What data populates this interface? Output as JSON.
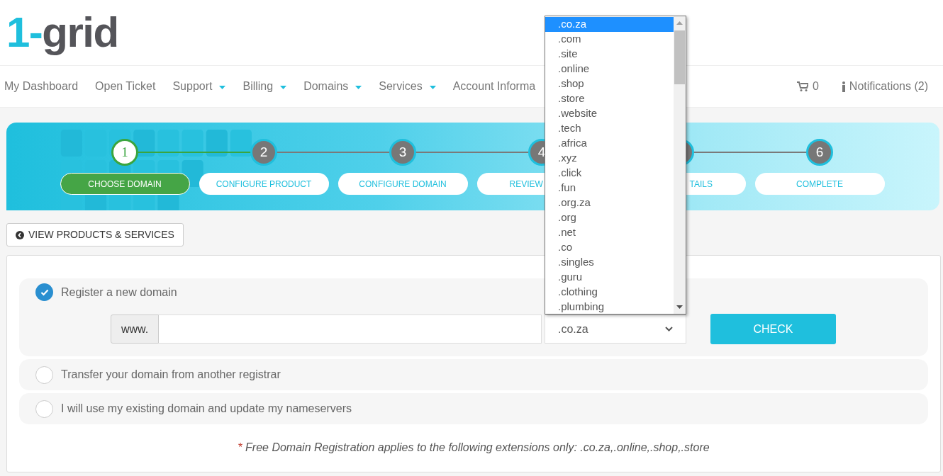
{
  "logo": {
    "accent": "1-",
    "text": "grid"
  },
  "nav": {
    "items": [
      {
        "label": "My Dashboard",
        "dropdown": false
      },
      {
        "label": "Open Ticket",
        "dropdown": false
      },
      {
        "label": "Support",
        "dropdown": true
      },
      {
        "label": "Billing",
        "dropdown": true
      },
      {
        "label": "Domains",
        "dropdown": true
      },
      {
        "label": "Services",
        "dropdown": true
      },
      {
        "label": "Account Informa",
        "dropdown": false
      }
    ],
    "cart_count": "0",
    "notifications": "Notifications (2)"
  },
  "steps": [
    {
      "number": "1",
      "label": "CHOOSE DOMAIN",
      "selected": true
    },
    {
      "number": "2",
      "label": "CONFIGURE PRODUCT",
      "selected": false
    },
    {
      "number": "3",
      "label": "CONFIGURE DOMAIN",
      "selected": false
    },
    {
      "number": "4",
      "label": "REVIEW",
      "selected": false
    },
    {
      "label": "TAILS",
      "selected": false
    },
    {
      "number": "6",
      "label": "COMPLETE",
      "selected": false
    }
  ],
  "back_button": "VIEW PRODUCTS & SERVICES",
  "domain_options": [
    {
      "label": "Register a new domain",
      "selected": true
    },
    {
      "label": "Transfer your domain from another registrar",
      "selected": false
    },
    {
      "label": "I will use my existing domain and update my nameservers",
      "selected": false
    }
  ],
  "domain_prefix": "www.",
  "tld_select": ".co.za",
  "check_button": "CHECK",
  "footnote": {
    "mark": "*",
    "text": "Free Domain Registration applies to the following extensions only: .co.za,.online,.shop,.store"
  },
  "tld_dropdown": [
    {
      "label": ".co.za",
      "selected": true
    },
    {
      "label": ".com",
      "selected": false
    },
    {
      "label": ".site",
      "selected": false
    },
    {
      "label": ".online",
      "selected": false
    },
    {
      "label": ".shop",
      "selected": false
    },
    {
      "label": ".store",
      "selected": false
    },
    {
      "label": ".website",
      "selected": false
    },
    {
      "label": ".tech",
      "selected": false
    },
    {
      "label": ".africa",
      "selected": false
    },
    {
      "label": ".xyz",
      "selected": false
    },
    {
      "label": ".click",
      "selected": false
    },
    {
      "label": ".fun",
      "selected": false
    },
    {
      "label": ".org.za",
      "selected": false
    },
    {
      "label": ".org",
      "selected": false
    },
    {
      "label": ".net",
      "selected": false
    },
    {
      "label": ".co",
      "selected": false
    },
    {
      "label": ".singles",
      "selected": false
    },
    {
      "label": ".guru",
      "selected": false
    },
    {
      "label": ".clothing",
      "selected": false
    },
    {
      "label": ".plumbing",
      "selected": false
    }
  ]
}
